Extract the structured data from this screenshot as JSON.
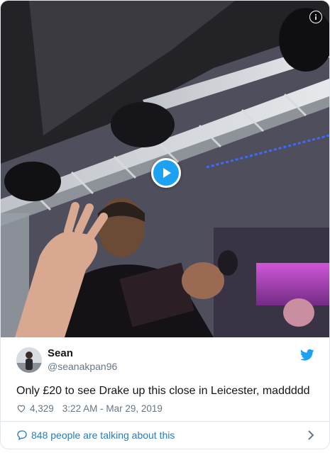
{
  "tweet": {
    "display_name": "Sean",
    "handle": "@seanakpan96",
    "text": "Only £20 to see Drake up this close in Leicester, maddddd",
    "likes": "4,329",
    "timestamp": "3:22 AM - Mar 29, 2019"
  },
  "footer": {
    "talking_label": "848 people are talking about this"
  },
  "icons": {
    "info": "info-icon",
    "play": "play-icon",
    "twitter": "twitter-bird-icon",
    "heart": "heart-icon",
    "reply": "speech-bubble-icon",
    "chevron": "chevron-right-icon"
  },
  "colors": {
    "accent": "#1da1f2",
    "link": "#2b7bb9",
    "secondary_text": "#657786",
    "border": "#e1e8ed"
  }
}
